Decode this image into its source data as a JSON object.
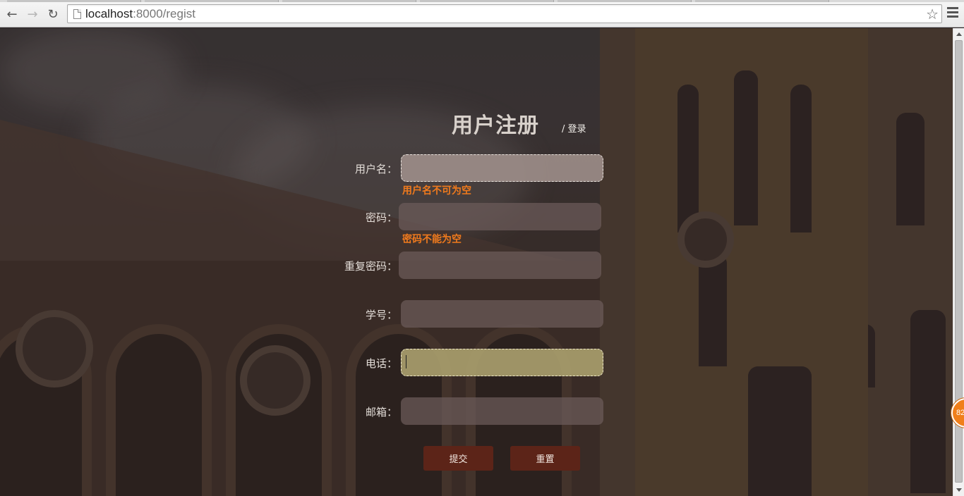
{
  "browser": {
    "url_host": "localhost",
    "url_rest": ":8000/regist",
    "icons": [
      "back-arrow-icon",
      "forward-arrow-icon",
      "reload-icon",
      "page-icon",
      "star-icon",
      "hamburger-menu-icon"
    ]
  },
  "form": {
    "title": "用户注册",
    "login_link": "/ 登录",
    "fields": {
      "username": {
        "label": "用户名：",
        "value": "",
        "error": "用户名不可为空"
      },
      "password": {
        "label": "密码：",
        "value": "",
        "error": "密码不能为空"
      },
      "repeat_password": {
        "label": "重复密码：",
        "value": ""
      },
      "student_id": {
        "label": "学号：",
        "value": ""
      },
      "phone": {
        "label": "电话：",
        "value": ""
      },
      "email": {
        "label": "邮箱：",
        "value": ""
      }
    },
    "submit_label": "提交",
    "reset_label": "重置"
  },
  "badge": {
    "text": "82"
  },
  "colors": {
    "error": "#f07a1d",
    "button": "#5c2418",
    "badge": "#f07f1a"
  }
}
